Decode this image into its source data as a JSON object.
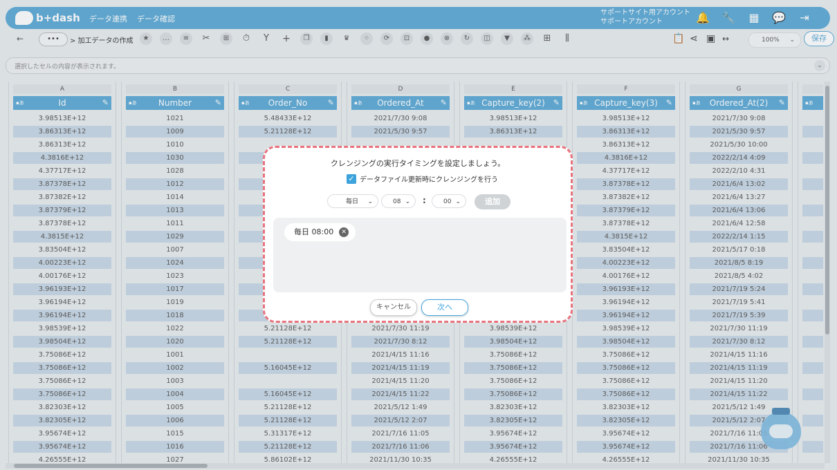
{
  "header": {
    "logo": "b+dash",
    "nav": [
      "データ連携",
      "データ確認"
    ],
    "account_line1": "サポートサイト用アカウント",
    "account_line2": "サポートアカウント",
    "icons": [
      "bell-icon",
      "wrench-icon",
      "grid-icon",
      "chat-icon",
      "logout-icon"
    ]
  },
  "toolbar": {
    "back": "←",
    "more": "•••",
    "breadcrumb": "> 加工データの作成",
    "zoom": "100%",
    "save": "保存"
  },
  "formula": {
    "placeholder": "選択したセルの内容が表示されます。"
  },
  "grid": {
    "letters": [
      "A",
      "B",
      "C",
      "D",
      "E",
      "F",
      "G",
      ""
    ],
    "headers": [
      "Id",
      "Number",
      "Order_No",
      "Ordered_At",
      "Capture_key(2)",
      "Capture_key(3)",
      "Ordered_At(2)",
      ""
    ],
    "rows": [
      [
        "3.98513E+12",
        "1021",
        "5.48433E+12",
        "2021/7/30 9:08",
        "3.98513E+12",
        "3.98513E+12",
        "2021/7/30 9:08",
        "[{ite"
      ],
      [
        "3.86313E+12",
        "1009",
        "5.21128E+12",
        "2021/5/30 9:57",
        "3.86313E+12",
        "3.86313E+12",
        "2021/5/30 9:57",
        "[{ite"
      ],
      [
        "3.86313E+12",
        "1010",
        "",
        "",
        "",
        "3.86313E+12",
        "2021/5/30 10:00",
        "[{ite"
      ],
      [
        "4.3816E+12",
        "1030",
        "",
        "",
        "",
        "4.3816E+12",
        "2022/2/14 4:09",
        "[{ite"
      ],
      [
        "4.37717E+12",
        "1028",
        "",
        "",
        "",
        "4.37717E+12",
        "2022/2/10 4:31",
        "[{ite"
      ],
      [
        "3.87378E+12",
        "1012",
        "",
        "",
        "",
        "3.87378E+12",
        "2021/6/4 13:02",
        "[{ite"
      ],
      [
        "3.87382E+12",
        "1014",
        "",
        "",
        "",
        "3.87382E+12",
        "2021/6/4 13:27",
        "[{ite"
      ],
      [
        "3.87379E+12",
        "1013",
        "",
        "",
        "",
        "3.87379E+12",
        "2021/6/4 13:06",
        "[{ite"
      ],
      [
        "3.87378E+12",
        "1011",
        "",
        "",
        "",
        "3.87378E+12",
        "2021/6/4 12:58",
        "[{ite"
      ],
      [
        "4.3815E+12",
        "1029",
        "",
        "",
        "",
        "4.3815E+12",
        "2022/2/14 1:15",
        "[{ite"
      ],
      [
        "3.83504E+12",
        "1007",
        "",
        "",
        "",
        "3.83504E+12",
        "2021/5/17 0:18",
        "[{ite"
      ],
      [
        "4.00223E+12",
        "1024",
        "",
        "",
        "",
        "4.00223E+12",
        "2021/8/5 8:19",
        "[{ite"
      ],
      [
        "4.00176E+12",
        "1023",
        "",
        "",
        "",
        "4.00176E+12",
        "2021/8/5 4:02",
        "[{ite"
      ],
      [
        "3.96193E+12",
        "1017",
        "",
        "",
        "",
        "3.96193E+12",
        "2021/7/19 5:24",
        "[{ite"
      ],
      [
        "3.96194E+12",
        "1019",
        "",
        "",
        "",
        "3.96194E+12",
        "2021/7/19 5:41",
        "[{ite"
      ],
      [
        "3.96194E+12",
        "1018",
        "",
        "",
        "",
        "3.96194E+12",
        "2021/7/19 5:39",
        "[{ite"
      ],
      [
        "3.98539E+12",
        "1022",
        "5.21128E+12",
        "2021/7/30 11:19",
        "3.98539E+12",
        "3.98539E+12",
        "2021/7/30 11:19",
        "[{ite"
      ],
      [
        "3.98504E+12",
        "1020",
        "5.21128E+12",
        "2021/7/30 8:12",
        "3.98504E+12",
        "3.98504E+12",
        "2021/7/30 8:12",
        "[{ite"
      ],
      [
        "3.75086E+12",
        "1001",
        "",
        "2021/4/15 11:16",
        "3.75086E+12",
        "3.75086E+12",
        "2021/4/15 11:16",
        "[{ite"
      ],
      [
        "3.75086E+12",
        "1002",
        "5.16045E+12",
        "2021/4/15 11:19",
        "3.75086E+12",
        "3.75086E+12",
        "2021/4/15 11:19",
        "[{ite"
      ],
      [
        "3.75086E+12",
        "1003",
        "",
        "2021/4/15 11:20",
        "3.75086E+12",
        "3.75086E+12",
        "2021/4/15 11:20",
        "[{ite"
      ],
      [
        "3.75086E+12",
        "1004",
        "5.16045E+12",
        "2021/4/15 11:22",
        "3.75086E+12",
        "3.75086E+12",
        "2021/4/15 11:22",
        "[{ite"
      ],
      [
        "3.82303E+12",
        "1005",
        "5.21128E+12",
        "2021/5/12 1:49",
        "3.82303E+12",
        "3.82303E+12",
        "2021/5/12 1:49",
        "[{ite"
      ],
      [
        "3.82305E+12",
        "1006",
        "5.21128E+12",
        "2021/5/12 2:07",
        "3.82305E+12",
        "3.82305E+12",
        "2021/5/12 2:07",
        "[{ite"
      ],
      [
        "3.95674E+12",
        "1015",
        "5.31317E+12",
        "2021/7/16 11:05",
        "3.95674E+12",
        "3.95674E+12",
        "2021/7/16 11:05",
        "[{ite"
      ],
      [
        "3.95674E+12",
        "1016",
        "5.21128E+12",
        "2021/7/16 11:06",
        "3.95674E+12",
        "3.95674E+12",
        "2021/7/16 11:06",
        "[{ite"
      ],
      [
        "4.26555E+12",
        "1027",
        "5.86102E+12",
        "2021/11/30 10:35",
        "4.26555E+12",
        "4.26555E+12",
        "2021/11/30 10:35",
        "[{ite"
      ]
    ]
  },
  "modal": {
    "title": "クレンジングの実行タイミングを設定しましょう。",
    "checkbox_label": "データファイル更新時にクレンジングを行う",
    "freq_value": "毎日",
    "hour_value": "08",
    "minute_value": "00",
    "add_label": "追加",
    "schedule_chip": "毎日 08:00",
    "cancel_label": "キャンセル",
    "next_label": "次へ"
  }
}
